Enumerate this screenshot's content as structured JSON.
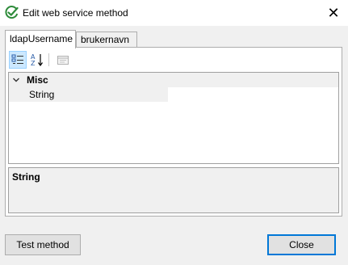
{
  "window": {
    "title": "Edit web service method",
    "icon": "check-circle-icon",
    "close_glyph": "✕"
  },
  "tabs": [
    {
      "label": "ldapUsername",
      "active": true
    },
    {
      "label": "brukernavn",
      "active": false
    }
  ],
  "toolbar": {
    "buttons": [
      {
        "name": "categorized-view-icon",
        "selected": true
      },
      {
        "name": "alphabetical-sort-icon",
        "selected": false
      },
      {
        "name": "property-pages-icon",
        "selected": false,
        "disabled": true
      }
    ]
  },
  "grid": {
    "category": {
      "label": "Misc",
      "expanded": true
    },
    "properties": [
      {
        "name": "String",
        "value": ""
      }
    ]
  },
  "description": {
    "title": "String"
  },
  "buttons": {
    "test_label": "Test method",
    "close_label": "Close"
  },
  "colors": {
    "accent": "#0078d7",
    "icon_green": "#2e8b3a"
  }
}
